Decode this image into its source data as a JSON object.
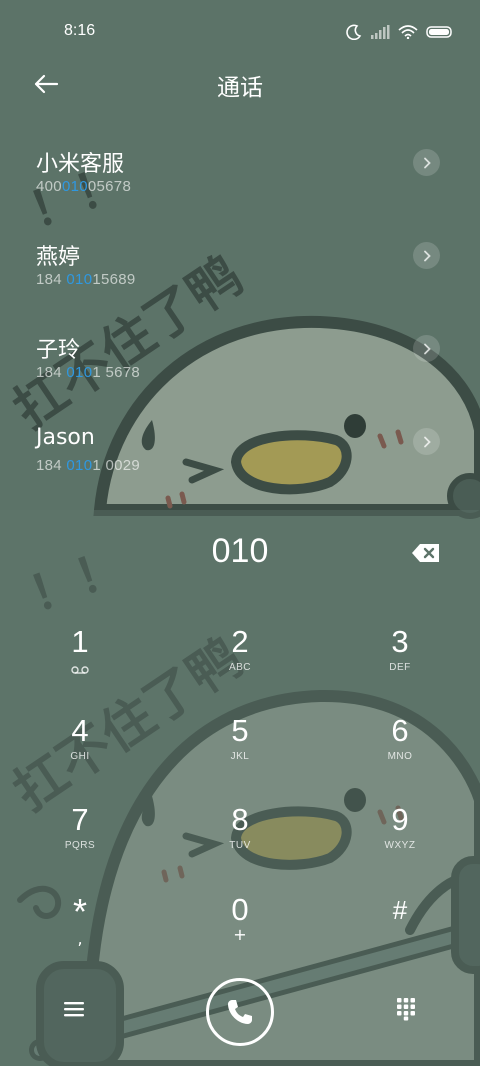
{
  "status_bar": {
    "time": "8:16",
    "icons": [
      "moon-icon",
      "signal-icon",
      "wifi-icon",
      "battery-icon"
    ]
  },
  "header": {
    "title": "通话",
    "back_icon": "back-arrow-icon"
  },
  "results": [
    {
      "name": "小米客服",
      "number_pre": "400",
      "number_match": "010",
      "number_post": "05678"
    },
    {
      "name": "燕婷",
      "number_pre": "184 ",
      "number_match": "010",
      "number_post": "15689"
    },
    {
      "name": "子玲",
      "number_pre": "184 ",
      "number_match": "010",
      "number_post": "1 5678"
    },
    {
      "name": "Jason",
      "number_pre": "184 ",
      "number_match": "010",
      "number_post": "1 0029"
    }
  ],
  "dialer": {
    "input": "010",
    "keys": [
      {
        "digit": "1",
        "letters": ""
      },
      {
        "digit": "2",
        "letters": "ABC"
      },
      {
        "digit": "3",
        "letters": "DEF"
      },
      {
        "digit": "4",
        "letters": "GHI"
      },
      {
        "digit": "5",
        "letters": "JKL"
      },
      {
        "digit": "6",
        "letters": "MNO"
      },
      {
        "digit": "7",
        "letters": "PQRS"
      },
      {
        "digit": "8",
        "letters": "TUV"
      },
      {
        "digit": "9",
        "letters": "WXYZ"
      },
      {
        "digit": "*",
        "letters": ","
      },
      {
        "digit": "0",
        "letters": "+"
      },
      {
        "digit": "#",
        "letters": ""
      }
    ]
  },
  "wallpaper_text": [
    "！！",
    "扛不住了鸭"
  ],
  "colors": {
    "background": "#5c7368",
    "highlight": "#2f98e0",
    "text": "#ffffff"
  }
}
